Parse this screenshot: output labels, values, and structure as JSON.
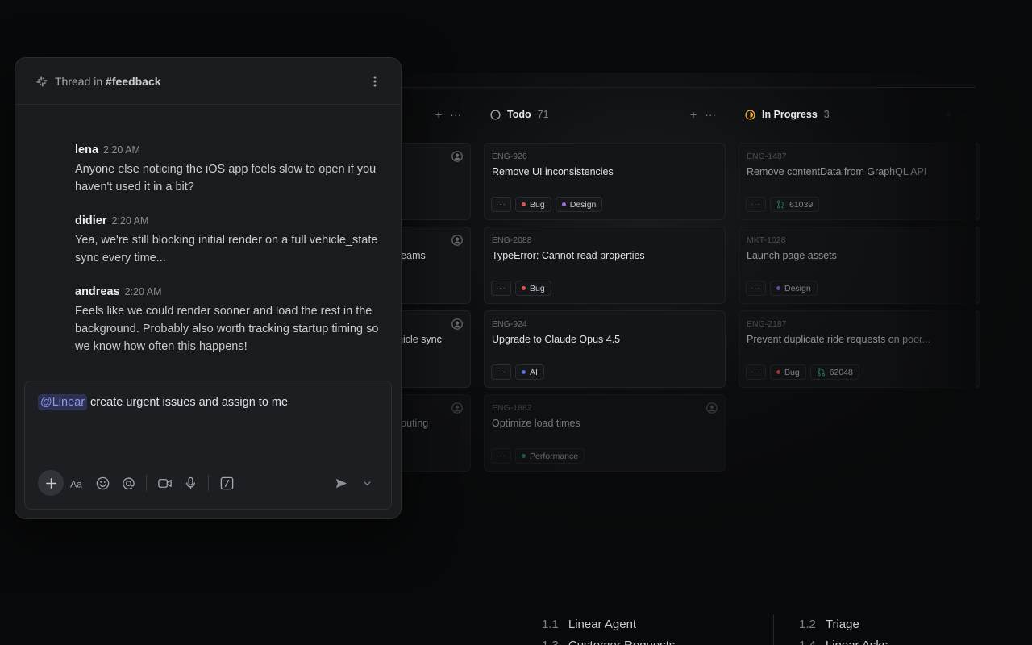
{
  "thread": {
    "title_prefix": "Thread in",
    "channel": "#feedback",
    "messages": [
      {
        "name": "lena",
        "time": "2:20 AM",
        "text": "Anyone else noticing the iOS app feels slow to open if you haven't used it in a bit?"
      },
      {
        "name": "didier",
        "time": "2:20 AM",
        "text": "Yea, we're still blocking initial render on a full vehicle_state sync every time..."
      },
      {
        "name": "andreas",
        "time": "2:20 AM",
        "text": "Feels like we could render sooner and load the rest in the background. Probably also worth tracking startup timing so we know how often this happens!"
      }
    ],
    "composer": {
      "mention": "@Linear",
      "text": "create urgent issues and assign to me"
    }
  },
  "board": {
    "partial_column": {
      "add": "+",
      "more": "···",
      "cards": [
        {
          "title_tail": ""
        },
        {
          "title_tail": "reams"
        },
        {
          "title_tail": "hicle sync"
        },
        {
          "title_tail": "routing"
        }
      ]
    },
    "todo": {
      "title": "Todo",
      "count": "71",
      "add": "+",
      "more": "···",
      "cards": [
        {
          "id": "ENG-926",
          "title": "Remove UI inconsistencies",
          "labels": [
            {
              "text": "Bug",
              "color": "#e5534b"
            },
            {
              "text": "Design",
              "color": "#9b6bdf"
            }
          ]
        },
        {
          "id": "ENG-2088",
          "title": "TypeError: Cannot read properties",
          "labels": [
            {
              "text": "Bug",
              "color": "#e5534b"
            }
          ]
        },
        {
          "id": "ENG-924",
          "title": "Upgrade to Claude Opus 4.5",
          "labels": [
            {
              "text": "AI",
              "color": "#5a6bd8"
            }
          ]
        },
        {
          "id": "ENG-1882",
          "title": "Optimize load times",
          "labels": [
            {
              "text": "Performance",
              "color": "#3aa675"
            }
          ]
        }
      ]
    },
    "in_progress": {
      "title": "In Progress",
      "count": "3",
      "add": "+",
      "more": "···",
      "cards": [
        {
          "id": "ENG-1487",
          "title": "Remove contentData from GraphQL API",
          "pr": "61039"
        },
        {
          "id": "MKT-1028",
          "title": "Launch page assets",
          "labels": [
            {
              "text": "Design",
              "color": "#9b6bdf"
            }
          ]
        },
        {
          "id": "ENG-2187",
          "title": "Prevent duplicate ride requests on poor...",
          "labels": [
            {
              "text": "Bug",
              "color": "#e5534b"
            }
          ],
          "pr": "62048"
        }
      ]
    },
    "more_label": "···"
  },
  "toc": [
    {
      "num": "1.1",
      "label": "Linear Agent"
    },
    {
      "num": "1.2",
      "label": "Triage"
    },
    {
      "num": "1.3",
      "label": "Customer Requests"
    },
    {
      "num": "1.4",
      "label": "Linear Asks"
    }
  ],
  "colors": {
    "accent": "#8e97e6",
    "in_progress": "#e2a93b",
    "pr_green": "#3aa675"
  }
}
